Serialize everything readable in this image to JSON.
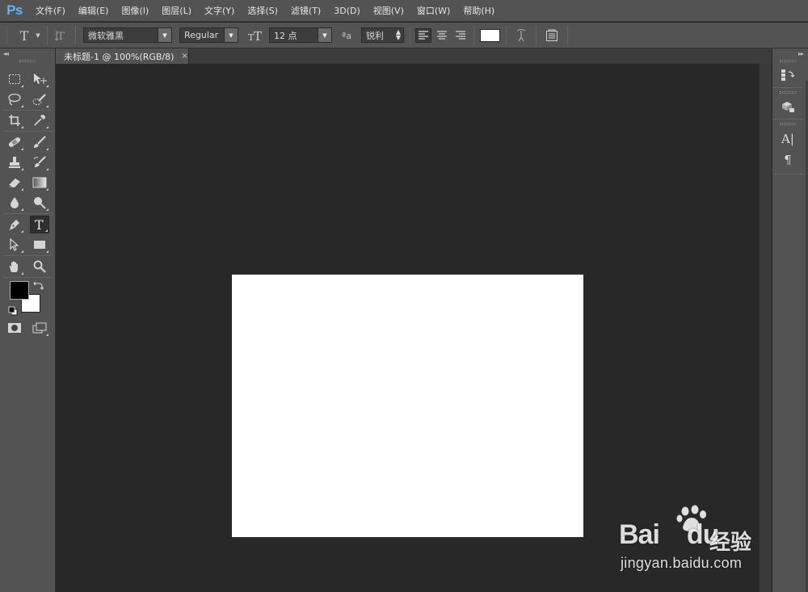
{
  "app": {
    "logo": "Ps",
    "menus": [
      "文件(F)",
      "编辑(E)",
      "图像(I)",
      "图层(L)",
      "文字(Y)",
      "选择(S)",
      "滤镜(T)",
      "3D(D)",
      "视图(V)",
      "窗口(W)",
      "帮助(H)"
    ]
  },
  "options_bar": {
    "tool_glyph": "T",
    "font_family": "微软雅黑",
    "font_style": "Regular",
    "font_size": "12 点",
    "antialias_glyph": "ªa",
    "antialias": "锐利",
    "text_color": "#ffffff",
    "icons": [
      "type-tool-icon",
      "toggle-orientation-icon",
      "font-size-icon",
      "antialias-icon",
      "align-left-icon",
      "align-center-icon",
      "align-right-icon",
      "warp-text-icon",
      "character-panel-icon"
    ]
  },
  "toolbar": {
    "collapse_glyph": "◂◂",
    "active_tool": "type",
    "foreground_color": "#000000",
    "background_color": "#ffffff",
    "tools": [
      "rectangular-marquee",
      "move",
      "lasso",
      "quick-selection",
      "crop",
      "eyedropper",
      "spot-healing",
      "brush",
      "clone-stamp",
      "history-brush",
      "eraser",
      "gradient",
      "blur",
      "dodge",
      "pen",
      "type",
      "path-selection",
      "rectangle",
      "hand",
      "zoom"
    ]
  },
  "document": {
    "tab_title": "未标题-1 @ 100%(RGB/8)",
    "close_glyph": "×",
    "canvas_color": "#ffffff",
    "workspace_color": "#282828"
  },
  "right_dock": {
    "collapse_glyph": "▸▸",
    "char_glyph": "A|",
    "para_glyph": "¶",
    "buttons": [
      "history-icon",
      "3d-properties-icon",
      "character-panel-icon",
      "paragraph-panel-icon"
    ]
  },
  "watermark": {
    "brand": "Bai",
    "brand_suffix": "du",
    "label": "经验",
    "url": "jingyan.baidu.com"
  },
  "colors": {
    "chrome": "#535353",
    "ps_blue": "#62b4f2"
  }
}
